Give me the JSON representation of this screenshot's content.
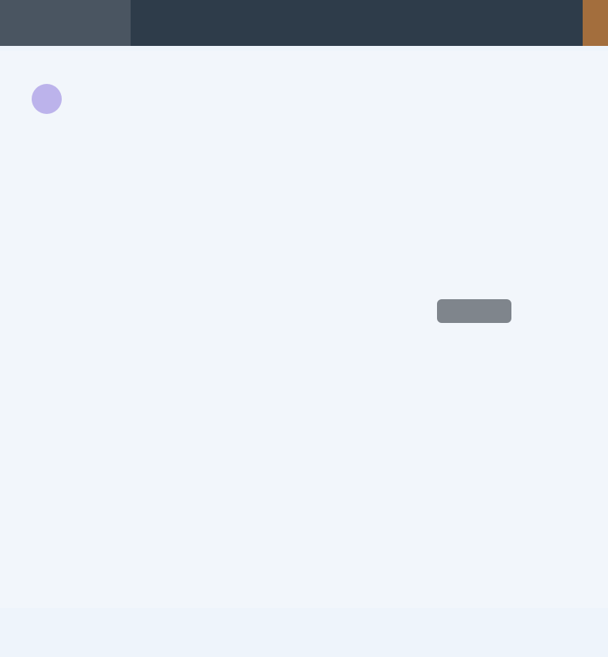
{
  "window": {
    "active_tab_label": "",
    "accent_color": "#c07a3a"
  },
  "brand": {
    "name": "",
    "logo_color": "#b3a7e8"
  },
  "nav_primary": {
    "items": [
      {
        "label": "",
        "active": true
      },
      {
        "label": ""
      },
      {
        "label": ""
      }
    ]
  },
  "nav_secondary": {
    "items": [
      {
        "label": ""
      },
      {
        "label": ""
      },
      {
        "label": ""
      },
      {
        "label": ""
      },
      {
        "label": ""
      },
      {
        "label": ""
      }
    ]
  },
  "section": {
    "title": ""
  },
  "table": {
    "header": {
      "col1": "",
      "col2": "",
      "action_button": "",
      "col4": ""
    },
    "rows": [
      {
        "c1": "",
        "c2": "",
        "c3": "",
        "c4": ""
      },
      {
        "c1": "",
        "c2": "",
        "c3": "",
        "c4": ""
      },
      {
        "c1": "",
        "c2": "",
        "c3": "",
        "c4": ""
      },
      {
        "c1": "",
        "c2": "",
        "c3": "",
        "c4": ""
      },
      {
        "c1": "",
        "c2": "",
        "c3": "",
        "c4": ""
      },
      {
        "c1": "",
        "c2": "",
        "c3": "",
        "c4": ""
      },
      {
        "c1": "",
        "c2": "",
        "c3": "",
        "c4": ""
      }
    ]
  }
}
